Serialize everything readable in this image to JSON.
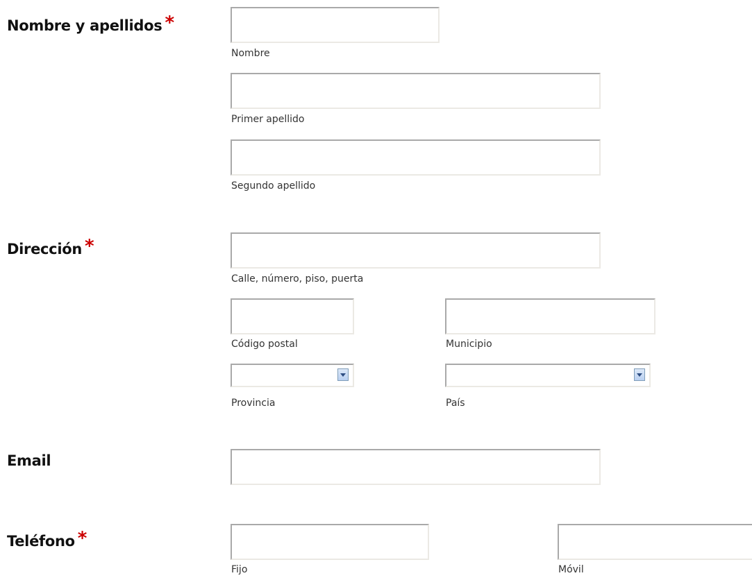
{
  "sections": {
    "nombre": {
      "label": "Nombre y apellidos",
      "required_mark": "*"
    },
    "direccion": {
      "label": "Dirección",
      "required_mark": "*"
    },
    "email": {
      "label": "Email"
    },
    "telefono": {
      "label": "Teléfono",
      "required_mark": "*"
    }
  },
  "fields": {
    "nombre": {
      "value": "",
      "hint": "Nombre"
    },
    "primer_apellido": {
      "value": "",
      "hint": "Primer apellido"
    },
    "segundo_apellido": {
      "value": "",
      "hint": "Segundo apellido"
    },
    "calle": {
      "value": "",
      "hint": "Calle, número, piso, puerta"
    },
    "codigo_postal": {
      "value": "",
      "hint": "Código postal"
    },
    "municipio": {
      "value": "",
      "hint": "Municipio"
    },
    "provincia": {
      "selected": "",
      "hint": "Provincia"
    },
    "pais": {
      "selected": "",
      "hint": "País"
    },
    "email": {
      "value": ""
    },
    "fijo": {
      "value": "",
      "hint": "Fijo"
    },
    "movil": {
      "value": "",
      "hint": "Móvil"
    }
  },
  "colors": {
    "required": "#cc0000",
    "dropdown_arrow": "#2d4d82"
  }
}
